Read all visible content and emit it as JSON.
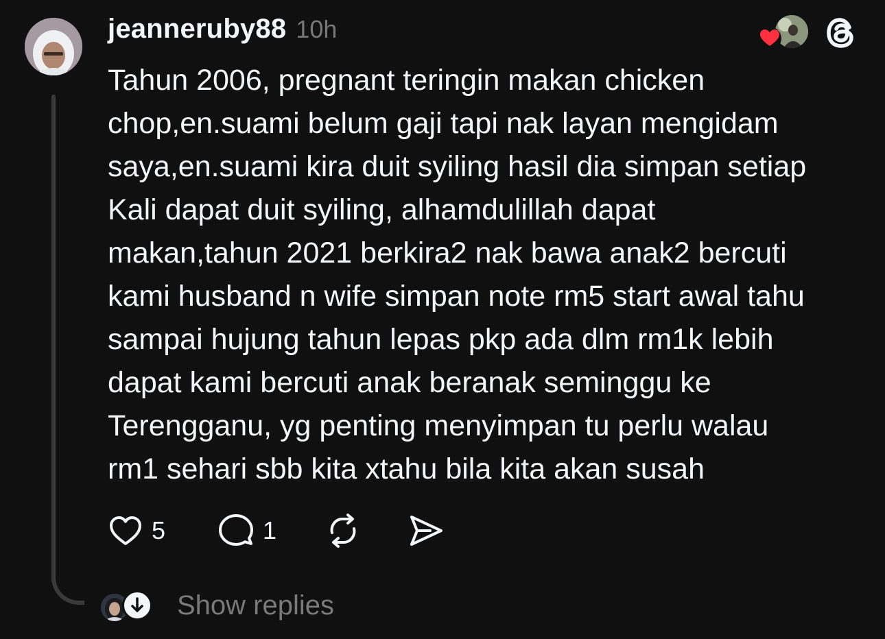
{
  "post": {
    "username": "jeanneruby88",
    "timestamp": "10h",
    "body_lines": [
      "Tahun 2006, pregnant teringin makan chicken",
      "chop,en.suami belum gaji tapi nak layan mengidam",
      "saya,en.suami kira duit syiling hasil dia simpan setiap",
      "Kali dapat duit syiling, alhamdulillah dapat",
      "makan,tahun 2021 berkira2 nak bawa anak2 bercuti",
      "kami husband n wife simpan note rm5 start awal tahu",
      "sampai hujung tahun lepas pkp ada dlm rm1k lebih",
      "dapat kami bercuti anak beranak seminggu ke",
      "Terengganu, yg penting menyimpan tu perlu walau",
      "rm1 sehari sbb kita xtahu bila kita akan susah"
    ]
  },
  "actions": {
    "like_count": "5",
    "reply_count": "1"
  },
  "replies": {
    "label": "Show replies"
  },
  "icons": {
    "like": "heart-outline-icon",
    "reply": "speech-bubble-icon",
    "repost": "repost-icon",
    "share": "send-icon",
    "liked_badge": "heart-filled-icon",
    "app_logo": "threads-logo-icon",
    "expand": "arrow-down-icon"
  },
  "colors": {
    "background": "#101010",
    "text": "#f3f5f7",
    "muted": "#777777",
    "heart": "#ff3040",
    "thread_line": "#3a3a3a"
  }
}
